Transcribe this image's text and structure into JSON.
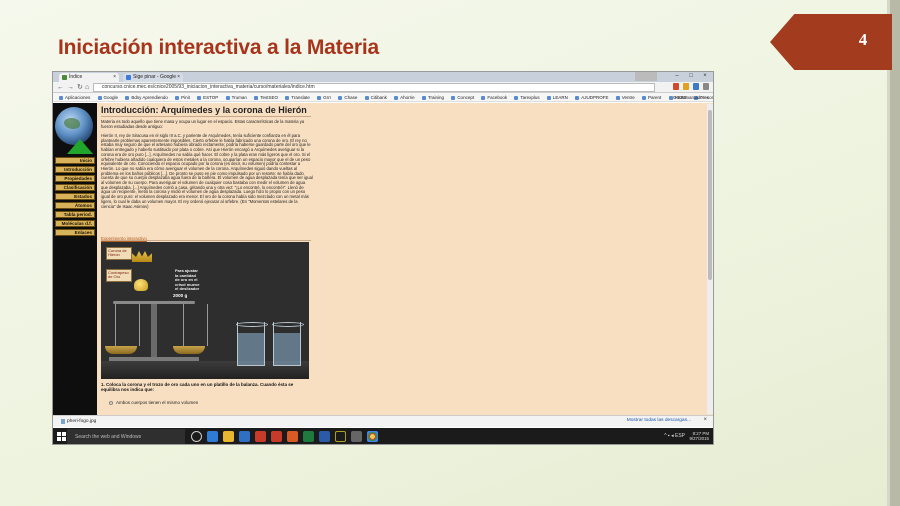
{
  "slide": {
    "title": "Iniciación interactiva a la Materia",
    "number": "4"
  },
  "browser": {
    "tabs": [
      {
        "label": "Índice"
      },
      {
        "label": "Sige pinar - Google Search"
      }
    ],
    "url": "concurso.cnice.mec.es/cnice2005/93_iniciacion_interactiva_materia/curso/materiales/indice.htm",
    "bookmarks": [
      "Aplicaciones",
      "Google",
      "Bdsy Aprendiendo",
      "Pinit",
      "ESTOP",
      "Truman",
      "TestSEO",
      "Translate",
      "Grrr",
      "Chase",
      "Citibank",
      "Ahorrie",
      "Training",
      "Concept",
      "Facebook",
      "Tarexplus",
      "LEARN",
      "AJUDPROFE",
      "Ventre",
      "Parent",
      "HSBB",
      "Freconnes"
    ],
    "bookmarks_other": "Otros marcadores"
  },
  "page": {
    "title": "Introducción: Arquímedes y la corona de Hierón",
    "intro": "Materia es todo aquello que tiene masa y ocupa un lugar en el espacio. Estas características de la materia ya fueron estudiadas desde antiguo:",
    "story": "Hierón II, rey de Siracusa en el siglo III a.C. y pariente de Arquímedes, tenía suficiente confianza en él para plantearle problemas aparentemente imposibles. Cierto orfebre le había fabricado una corona de oro. El rey no estaba muy seguro de que el artesano hubiera obrado rectamente; podría haberse guardado parte del oro que le habían entregado y haberlo sustituido por plata o cobre. Así que Hierón encargó a Arquímedes averiguar si la corona era de oro puro [...]. Arquímedes no sabía qué hacer. El cobre y la plata eran más ligeros que el oro. Si el orfebre hubiera añadido cualquiera de estos metales a la corona, ocuparían un espacio mayor que el de un peso equivalente de oro. Conociendo el espacio ocupado por la corona (es decir, su volumen) podría contestar a Hierón. Lo que no sabía era cómo averiguar el volumen de la corona. Arquímedes siguió dando vueltas al problema en los baños públicos [...]. De pronto se puso en pie como impulsado por un resorte: se había dado cuenta de que su cuerpo desplazaba agua fuera de la bañera. El volumen de agua desplazada tenía que ser igual al volumen de su cuerpo. Para averiguar el volumen de cualquier cosa bastaba con medir el volumen de agua que desplazaba. [...] Arquímedes corrió a casa, gritando una y otra vez: \"¡Lo encontré, lo encontré!\". Llenó de agua un recipiente, metió la corona y midió el volumen de agua desplazada. Luego hizo lo propio con un peso igual de oro puro: el volumen desplazado era menor. El oro de la corona había sido mezclado con un metal más ligero, lo cual le daba un volumen mayor. El rey ordenó ejecutar al orfebre. (En \"Momentos estelares de la ciencia\" de Isaac Asimov)",
    "link": "Experimento interactivo",
    "question": "1. Coloca la corona y el trozo de oro cada uno en un platillo de la balanza. Cuando ésta se equilibra nos indica que:",
    "option1": "Ambos cuerpos tienen el mismo volumen"
  },
  "sidebar": {
    "items": [
      "Inicio",
      "Introducción",
      "Propiedades",
      "Clasificación",
      "Estados",
      "Átomos",
      "Tabla period.",
      "Moléculas d.f.",
      "Enlaces"
    ]
  },
  "simulation": {
    "crown_label": "Corona de Hierón",
    "gold_label": "Contrapeso de Oro",
    "info": "Para ajustar la cantidad de oro en el crisol mueve el deslizador",
    "weight": "2000 g"
  },
  "downloads": {
    "file": "pheri-fogo.jpg",
    "show_all": "Mostrar todas las descargas..."
  },
  "taskbar": {
    "search_placeholder": "Search the web and Windows",
    "time": "8:27 PM",
    "date": "9/27/2015",
    "lang": "ESP"
  }
}
